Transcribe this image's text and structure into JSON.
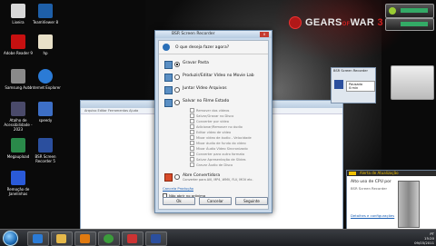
{
  "wallpaper": {
    "logo_main": "GEARS",
    "logo_of": "OF",
    "logo_war": "WAR",
    "logo_num": "3"
  },
  "desktop_icons": [
    {
      "label": "Lixeira",
      "color": "#d8d8d8"
    },
    {
      "label": "TeamViewer 8",
      "color": "#1e5fa8"
    },
    {
      "label": "Adobe Reader 9",
      "color": "#c71010"
    },
    {
      "label": "hp",
      "color": "#e8e0c8"
    },
    {
      "label": "Samsung Auto",
      "color": "#8a8a8a"
    },
    {
      "label": "Internet Explorer",
      "color": "#2b7bd6"
    },
    {
      "label": "Atalho de Acessibilidade - 2023",
      "color": "#4a4a6a"
    },
    {
      "label": "speedy",
      "color": "#3d6fc6"
    },
    {
      "label": "Megaupload",
      "color": "#2a8a4a"
    },
    {
      "label": "BSR Screen Recorder 5",
      "color": "#2b4f9e"
    },
    {
      "label": "Remoção de Janelinhas",
      "color": "#2a5ad8"
    }
  ],
  "background_window": {
    "title": "",
    "menu": "Arquivo   Editar   Ferramentas   Ajuda"
  },
  "dialog": {
    "title": "BSR Screen Recorder",
    "close": "x",
    "question": "O que deseja fazer agora?",
    "options": [
      {
        "label": "Gravar Pasta",
        "selected": true
      },
      {
        "label": "Produzir/Editar Vídeo no Movie Lab",
        "selected": false
      },
      {
        "label": "Juntar Vídeo Arquivos",
        "selected": false
      },
      {
        "label": "Salvar no Filme Estado",
        "selected": false
      }
    ],
    "sub_items": [
      "Remover dos vídeos",
      "Salvar/Gravar no Disco",
      "Converter por vídeo",
      "Adicionar/Remover no áudio",
      "Editar vídeo de vídeo",
      "Mixar vídeo de áudio - Velocidade",
      "Mixar áudio de fundo do vídeo",
      "Mixar Áudio Vídeo Sincronizado",
      "Converter para outro formato",
      "Salvar Apresentação de Slides",
      "Gravar Áudio de Disco"
    ],
    "last_option": "Abre Convertidora",
    "last_hint": "Converter para AVI, MP4, WMV, FLV, MOV etc.",
    "link": "Cancela Produção",
    "checkbox_label": "Não abrir no próximo",
    "btn_ok": "Ok",
    "btn_cancel": "Cancelar",
    "btn_next": "Seguinte"
  },
  "mini_window": {
    "title": "BSR Screen Recorder",
    "button": "Pausado 0:min"
  },
  "notification": {
    "header": "Alerta de Atualização",
    "title": "Alto uso de CPU por",
    "subtitle": "BSR Screen Recorder",
    "link": "Detalhes e configurações"
  },
  "taskbar": {
    "lang": "PT",
    "time": "15:20",
    "date": "09/03/2011"
  }
}
